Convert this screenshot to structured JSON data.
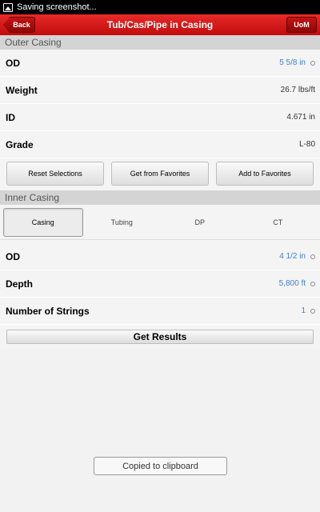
{
  "status_bar": {
    "text": "Saving screenshot..."
  },
  "header": {
    "back_label": "Back",
    "title": "Tub/Cas/Pipe in Casing",
    "uom_label": "UoM"
  },
  "outer_casing": {
    "title": "Outer Casing",
    "rows": [
      {
        "label": "OD",
        "value": "5 5/8  in",
        "editable": true
      },
      {
        "label": "Weight",
        "value": "26.7 lbs/ft",
        "editable": false
      },
      {
        "label": "ID",
        "value": "4.671 in",
        "editable": false
      },
      {
        "label": "Grade",
        "value": "L-80",
        "editable": false
      }
    ],
    "buttons": [
      "Reset Selections",
      "Get from Favorites",
      "Add to Favorites"
    ]
  },
  "inner_casing": {
    "title": "Inner Casing",
    "tabs": [
      "Casing",
      "Tubing",
      "DP",
      "CT"
    ],
    "active_tab": "Casing",
    "rows": [
      {
        "label": "OD",
        "value": "4 1/2  in",
        "editable": true
      },
      {
        "label": "Depth",
        "value": "5,800 ft",
        "editable": true
      },
      {
        "label": "Number of Strings",
        "value": "1",
        "editable": true
      }
    ],
    "results_label": "Get Results"
  },
  "toast": {
    "text": "Copied to clipboard"
  },
  "colors": {
    "accent_red": "#d61a1a",
    "value_blue": "#3f7fce"
  }
}
